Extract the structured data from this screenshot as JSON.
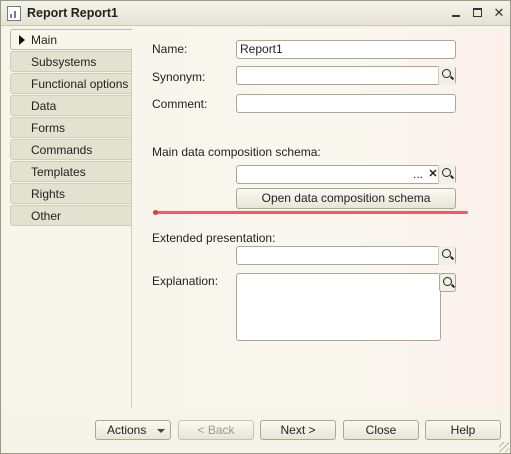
{
  "window": {
    "title": "Report Report1"
  },
  "tabs": [
    {
      "label": "Main",
      "active": true
    },
    {
      "label": "Subsystems"
    },
    {
      "label": "Functional options"
    },
    {
      "label": "Data"
    },
    {
      "label": "Forms"
    },
    {
      "label": "Commands"
    },
    {
      "label": "Templates"
    },
    {
      "label": "Rights"
    },
    {
      "label": "Other"
    }
  ],
  "form": {
    "name_label": "Name:",
    "name_value": "Report1",
    "synonym_label": "Synonym:",
    "synonym_value": "",
    "comment_label": "Comment:",
    "comment_value": "",
    "schema_label": "Main data composition schema:",
    "schema_value": "",
    "open_schema_button": "Open data composition schema",
    "extended_presentation_label": "Extended presentation:",
    "extended_presentation_value": "",
    "explanation_label": "Explanation:",
    "explanation_value": ""
  },
  "icons": {
    "ellipsis": "...",
    "clear": "✕",
    "search": "search-icon"
  },
  "footer": {
    "actions": "Actions",
    "back": "< Back",
    "next": "Next >",
    "close": "Close",
    "help": "Help"
  },
  "colors": {
    "background": "#f6f4e8",
    "highlight_line": "#ef5d64"
  }
}
